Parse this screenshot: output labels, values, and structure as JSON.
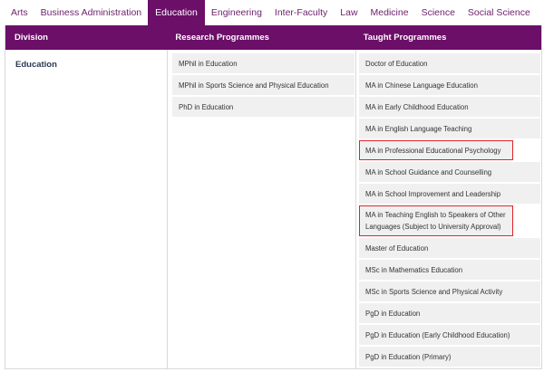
{
  "tabs": [
    {
      "label": "Arts",
      "active": false
    },
    {
      "label": "Business Administration",
      "active": false
    },
    {
      "label": "Education",
      "active": true
    },
    {
      "label": "Engineering",
      "active": false
    },
    {
      "label": "Inter-Faculty",
      "active": false
    },
    {
      "label": "Law",
      "active": false
    },
    {
      "label": "Medicine",
      "active": false
    },
    {
      "label": "Science",
      "active": false
    },
    {
      "label": "Social Science",
      "active": false
    }
  ],
  "table": {
    "headers": {
      "division": "Division",
      "research": "Research Programmes",
      "taught": "Taught Programmes"
    },
    "division": "Education",
    "research_programmes": [
      "MPhil in Education",
      "MPhil in Sports Science and Physical Education",
      "PhD in Education"
    ],
    "taught_programmes": [
      {
        "label": "Doctor of Education",
        "highlighted": false
      },
      {
        "label": "MA in Chinese Language Education",
        "highlighted": false
      },
      {
        "label": "MA in Early Childhood Education",
        "highlighted": false
      },
      {
        "label": "MA in English Language Teaching",
        "highlighted": false
      },
      {
        "label": "MA in Professional Educational Psychology",
        "highlighted": true
      },
      {
        "label": "MA in School Guidance and Counselling",
        "highlighted": false
      },
      {
        "label": "MA in School Improvement and Leadership",
        "highlighted": false
      },
      {
        "label": "MA in Teaching English to Speakers of Other Languages (Subject to University Approval)",
        "highlighted": true
      },
      {
        "label": "Master of Education",
        "highlighted": false
      },
      {
        "label": "MSc in Mathematics Education",
        "highlighted": false
      },
      {
        "label": "MSc in Sports Science and Physical Activity",
        "highlighted": false
      },
      {
        "label": "PgD in Education",
        "highlighted": false
      },
      {
        "label": "PgD in Education (Early Childhood Education)",
        "highlighted": false
      },
      {
        "label": "PgD in Education (Primary)",
        "highlighted": false
      }
    ]
  },
  "colors": {
    "brand_purple": "#6b0f68",
    "tab_text": "#6d1f6b",
    "highlight_red": "#e0242a"
  }
}
